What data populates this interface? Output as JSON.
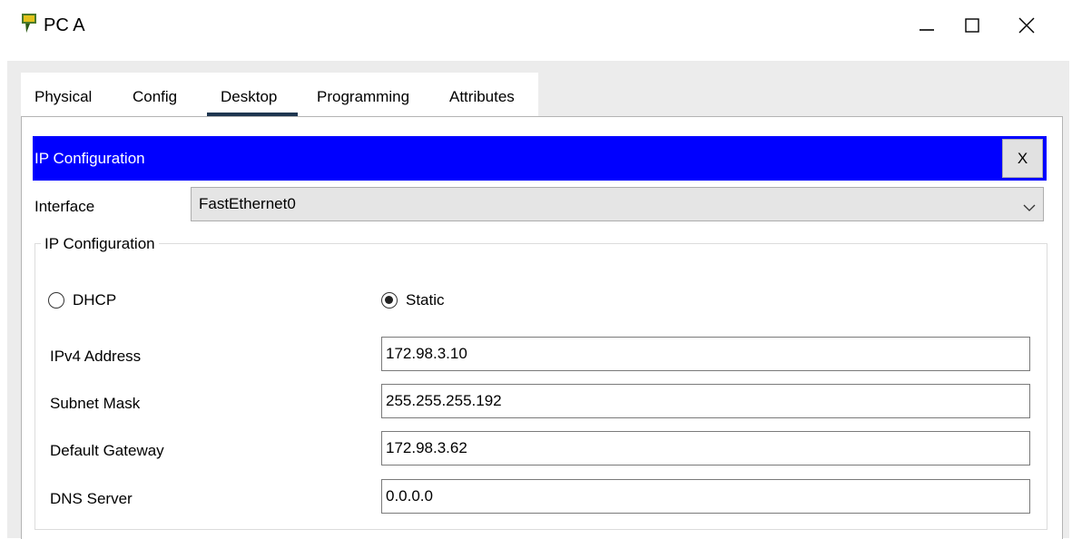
{
  "window": {
    "title": "PC A",
    "controls": {
      "minimize": "minimize-icon",
      "maximize": "maximize-icon",
      "close": "close-icon"
    }
  },
  "tabs": [
    {
      "label": "Physical"
    },
    {
      "label": "Config"
    },
    {
      "label": "Desktop",
      "active": true
    },
    {
      "label": "Programming"
    },
    {
      "label": "Attributes"
    }
  ],
  "ip_panel": {
    "title": "IP Configuration",
    "close_label": "X",
    "interface_label": "Interface",
    "interface_value": "FastEthernet0",
    "group_title": "IP Configuration",
    "mode": {
      "dhcp_label": "DHCP",
      "static_label": "Static",
      "selected": "Static"
    },
    "fields": {
      "ipv4": {
        "label": "IPv4 Address",
        "value": "172.98.3.10"
      },
      "subnet": {
        "label": "Subnet Mask",
        "value": "255.255.255.192"
      },
      "gateway": {
        "label": "Default Gateway",
        "value": "172.98.3.62"
      },
      "dns": {
        "label": "DNS Server",
        "value": "0.0.0.0"
      }
    }
  },
  "colors": {
    "title_bar_blue": "#0000ff",
    "tab_underline": "#1e3650",
    "frame_gray": "#ececec"
  }
}
